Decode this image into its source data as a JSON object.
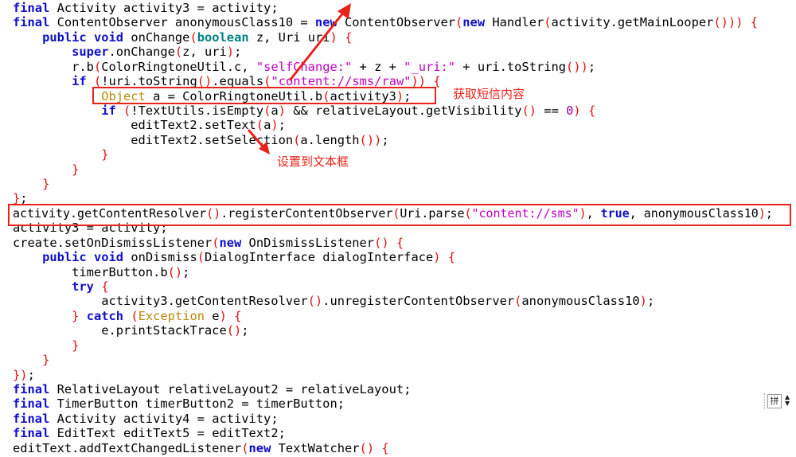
{
  "code": {
    "indent_unit": "    ",
    "lines": [
      {
        "indent": 0,
        "text": "final Activity activity3 = activity;"
      },
      {
        "indent": 0,
        "text": "final ContentObserver anonymousClass10 = new ContentObserver(new Handler(activity.getMainLooper())) {"
      },
      {
        "indent": 1,
        "text": "public void onChange(boolean z, Uri uri) {"
      },
      {
        "indent": 2,
        "text": "super.onChange(z, uri);"
      },
      {
        "indent": 2,
        "text": "r.b(ColorRingtoneUtil.c, \"selfChange:\" + z + \"_uri:\" + uri.toString());"
      },
      {
        "indent": 2,
        "text": "if (!uri.toString().equals(\"content://sms/raw\")) {"
      },
      {
        "indent": 3,
        "text": "Object a = ColorRingtoneUtil.b(activity3);"
      },
      {
        "indent": 3,
        "text": "if (!TextUtils.isEmpty(a) && relativeLayout.getVisibility() == 0) {"
      },
      {
        "indent": 4,
        "text": "editText2.setText(a);"
      },
      {
        "indent": 4,
        "text": "editText2.setSelection(a.length());"
      },
      {
        "indent": 3,
        "text": "}"
      },
      {
        "indent": 2,
        "text": "}"
      },
      {
        "indent": 1,
        "text": "}"
      },
      {
        "indent": 0,
        "text": "};"
      },
      {
        "indent": 0,
        "text": "activity.getContentResolver().registerContentObserver(Uri.parse(\"content://sms\"), true, anonymousClass10);"
      },
      {
        "indent": 0,
        "text": "activity3 = activity;"
      },
      {
        "indent": 0,
        "text": "create.setOnDismissListener(new OnDismissListener() {"
      },
      {
        "indent": 1,
        "text": "public void onDismiss(DialogInterface dialogInterface) {"
      },
      {
        "indent": 2,
        "text": "timerButton.b();"
      },
      {
        "indent": 2,
        "text": "try {"
      },
      {
        "indent": 3,
        "text": "activity3.getContentResolver().unregisterContentObserver(anonymousClass10);"
      },
      {
        "indent": 2,
        "text": "} catch (Exception e) {"
      },
      {
        "indent": 3,
        "text": "e.printStackTrace();"
      },
      {
        "indent": 2,
        "text": "}"
      },
      {
        "indent": 1,
        "text": "}"
      },
      {
        "indent": 0,
        "text": "});"
      },
      {
        "indent": 0,
        "text": "final RelativeLayout relativeLayout2 = relativeLayout;"
      },
      {
        "indent": 0,
        "text": "final TimerButton timerButton2 = timerButton;"
      },
      {
        "indent": 0,
        "text": "final Activity activity4 = activity;"
      },
      {
        "indent": 0,
        "text": "final EditText editText5 = editText2;"
      },
      {
        "indent": 0,
        "text": "editText.addTextChangedListener(new TextWatcher() {"
      }
    ]
  },
  "annotations": {
    "get_sms_label": "获取短信内容",
    "set_textbox_label": "设置到文本框",
    "color": "#e8231a"
  },
  "ime_indicator": {
    "label": "拼",
    "icon": "ime-pinyin-icon"
  },
  "syntax_colors": {
    "keyword": "#1010c8",
    "string": "#c000c0",
    "bracket": "#e01010",
    "primitive": "#008080",
    "class": "#b8860b",
    "number": "#a000a0"
  }
}
